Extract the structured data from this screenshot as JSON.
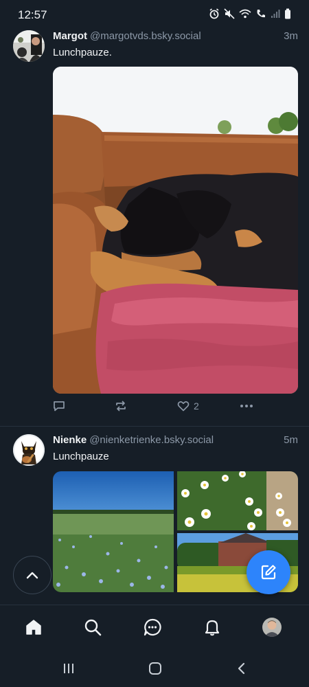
{
  "status_bar": {
    "time": "12:57"
  },
  "posts": [
    {
      "author_name": "Margot",
      "author_handle": "@margotvds.bsky.social",
      "time": "3m",
      "text": "Lunchpauze.",
      "like_count": "2"
    },
    {
      "author_name": "Nienke",
      "author_handle": "@nienketrienke.bsky.social",
      "time": "5m",
      "text": "Lunchpauze"
    }
  ],
  "colors": {
    "accent": "#2d84fb",
    "background": "#161e27",
    "muted": "#8c98a7"
  },
  "nav": {
    "items": [
      "home-icon",
      "search-icon",
      "chat-icon",
      "bell-icon",
      "profile-avatar"
    ]
  }
}
